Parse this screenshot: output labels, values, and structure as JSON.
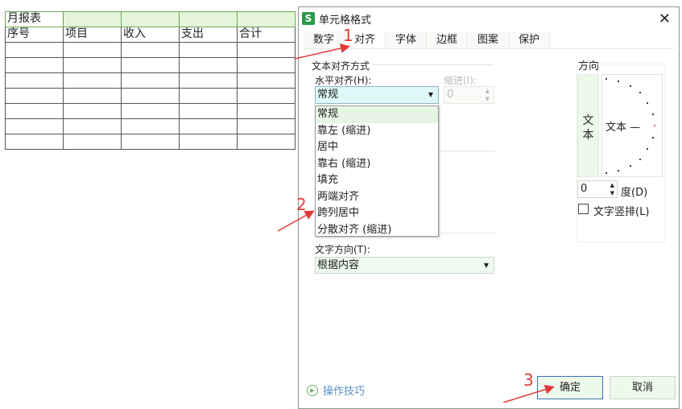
{
  "sheet": {
    "title": "月报表",
    "headers": [
      "序号",
      "项目",
      "收入",
      "支出",
      "合计"
    ]
  },
  "dialog": {
    "title": "单元格格式",
    "tabs": [
      "数字",
      "对齐",
      "字体",
      "边框",
      "图案",
      "保护"
    ],
    "align_section": "文本对齐方式",
    "horizontal_label": "水平对齐(H):",
    "horizontal_value": "常规",
    "indent_label": "缩进(I):",
    "indent_value": "0",
    "options": [
      "常规",
      "靠左 (缩进)",
      "居中",
      "靠右 (缩进)",
      "填充",
      "两端对齐",
      "跨列居中",
      "分散对齐 (缩进)"
    ],
    "direction_label": "文字方向(T):",
    "direction_value": "根据内容",
    "orientation_title": "方向",
    "vertical_text": "文本",
    "dial_text": "文本 —",
    "degree_value": "0",
    "degree_label": "度(D)",
    "vertical_checkbox": "文字竖排(L)",
    "tips": "操作技巧",
    "ok": "确定",
    "cancel": "取消"
  },
  "annotations": [
    "1",
    "2",
    "3"
  ],
  "colors": {
    "accent": "#2d9a4c",
    "annotation": "#e03a3a"
  }
}
